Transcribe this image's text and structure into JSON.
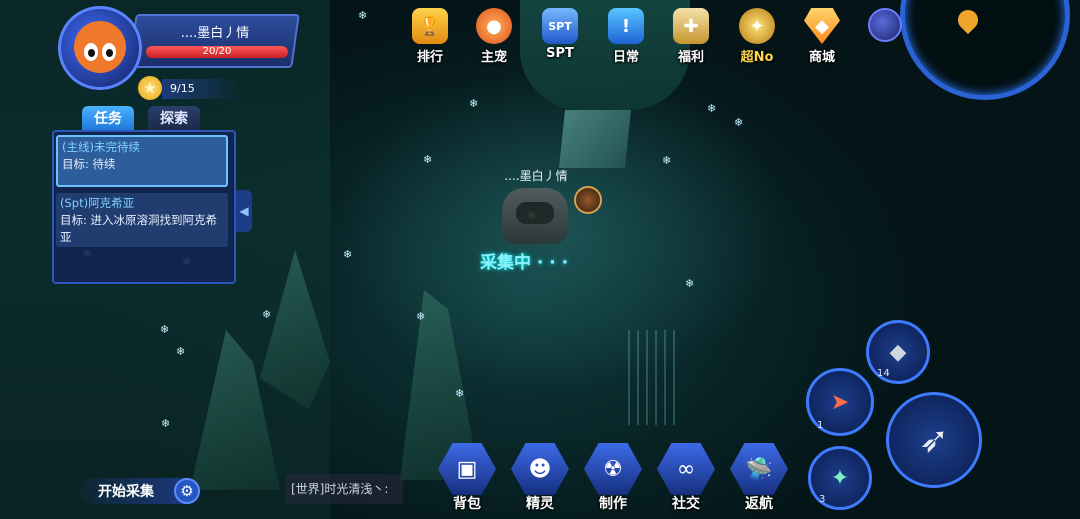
{
  "player": {
    "name": "....墨白丿情",
    "hp_text": "20/20",
    "hp_fraction": 1.0,
    "star_count": "9/15"
  },
  "quest_panel": {
    "tabs": [
      "任务",
      "探索"
    ],
    "quests": [
      {
        "title": "(主线)未完待续",
        "desc": "目标:  待续"
      },
      {
        "title": "(Spt)阿克希亚",
        "desc": "目标:  进入冰原溶洞找到阿克希亚"
      }
    ]
  },
  "top_menu": [
    {
      "label": "排行",
      "icon": "trophy-icon",
      "color": "#f2a21a"
    },
    {
      "label": "主宠",
      "icon": "pet-icon",
      "color": "#ff7a2a"
    },
    {
      "label": "SPT",
      "icon": "spt-badge-icon",
      "color": "#3a8cff"
    },
    {
      "label": "日常",
      "icon": "daily-icon",
      "color": "#2f7fe6"
    },
    {
      "label": "福利",
      "icon": "gift-icon",
      "color": "#d9b05a"
    },
    {
      "label": "超No",
      "icon": "chaono-icon",
      "color": "#f0c23a"
    },
    {
      "label": "商城",
      "icon": "diamond-icon",
      "color": "#ffb347"
    }
  ],
  "scene": {
    "character_name": "....墨白丿情",
    "status_text": "采集中 · · ·"
  },
  "bottom": {
    "gather_label": "开始采集",
    "chat_text": "[世界]时光清浅丶:",
    "buttons": [
      {
        "label": "背包",
        "icon": "backpack-icon"
      },
      {
        "label": "精灵",
        "icon": "spirit-icon"
      },
      {
        "label": "制作",
        "icon": "craft-icon"
      },
      {
        "label": "社交",
        "icon": "social-icon"
      },
      {
        "label": "返航",
        "icon": "ufo-icon"
      }
    ]
  },
  "skills": [
    {
      "name": "crystal-item",
      "count": "14"
    },
    {
      "name": "fish-item",
      "count": "1"
    },
    {
      "name": "capsule-item",
      "count": "3"
    },
    {
      "name": "drill-action",
      "count": ""
    }
  ]
}
